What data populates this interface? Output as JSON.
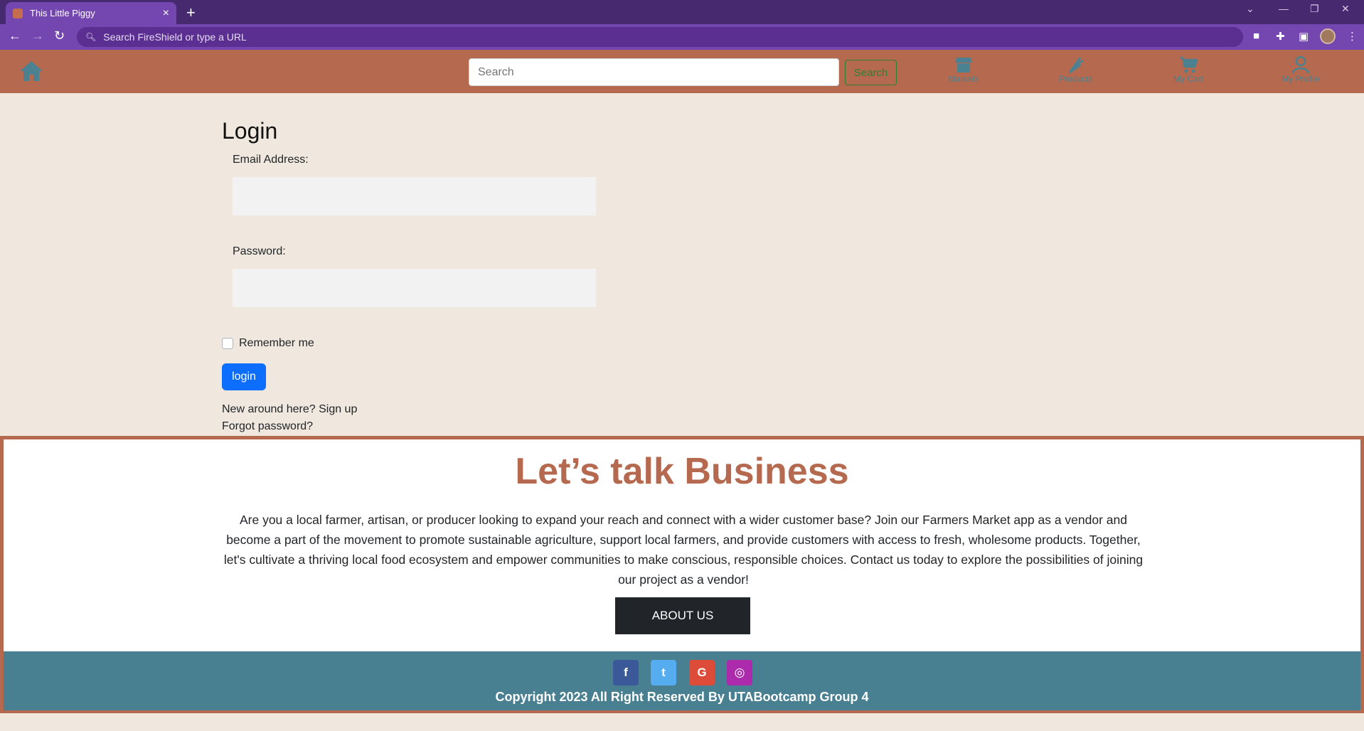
{
  "browser": {
    "tab_title": "This Little Piggy",
    "tab_close": "×",
    "new_tab": "+",
    "omnibox_placeholder": "Search FireShield or type a URL"
  },
  "nav": {
    "search_placeholder": "Search",
    "search_button": "Search",
    "links": [
      {
        "label": "Markets",
        "icon": "store-icon"
      },
      {
        "label": "Products",
        "icon": "carrot-icon"
      },
      {
        "label": "My Cart",
        "icon": "cart-icon"
      },
      {
        "label": "My Profile",
        "icon": "user-icon"
      }
    ]
  },
  "login": {
    "title": "Login",
    "email_label": "Email Address:",
    "password_label": "Password:",
    "remember_label": "Remember me",
    "login_button": "login",
    "signup_text": "New around here? Sign up",
    "forgot_text": "Forgot password?"
  },
  "business": {
    "title": "Let’s talk Business",
    "body": "Are you a local farmer, artisan, or producer looking to expand your reach and connect with a wider customer base? Join our Farmers Market app as a vendor and become a part of the movement to promote sustainable agriculture, support local farmers, and provide customers with access to fresh, wholesome products. Together, let's cultivate a thriving local food ecosystem and empower communities to make conscious, responsible choices. Contact us today to explore the possibilities of joining our project as a vendor!",
    "about_button": "ABOUT US"
  },
  "footer": {
    "social": [
      {
        "name": "facebook",
        "glyph": "f",
        "color": "#3b5998"
      },
      {
        "name": "twitter",
        "glyph": "t",
        "color": "#55acee"
      },
      {
        "name": "google",
        "glyph": "G",
        "color": "#dd4b39"
      },
      {
        "name": "instagram",
        "glyph": "◎",
        "color": "#ac2bac"
      }
    ],
    "copyright": "Copyright 2023 All Right Reserved By UTABootcamp Group 4"
  },
  "colors": {
    "nav_bg": "#b56a50",
    "page_bg": "#f0e8de",
    "footer_bg": "#487f91",
    "icon_teal": "#4b8190",
    "primary": "#0d6efd"
  }
}
